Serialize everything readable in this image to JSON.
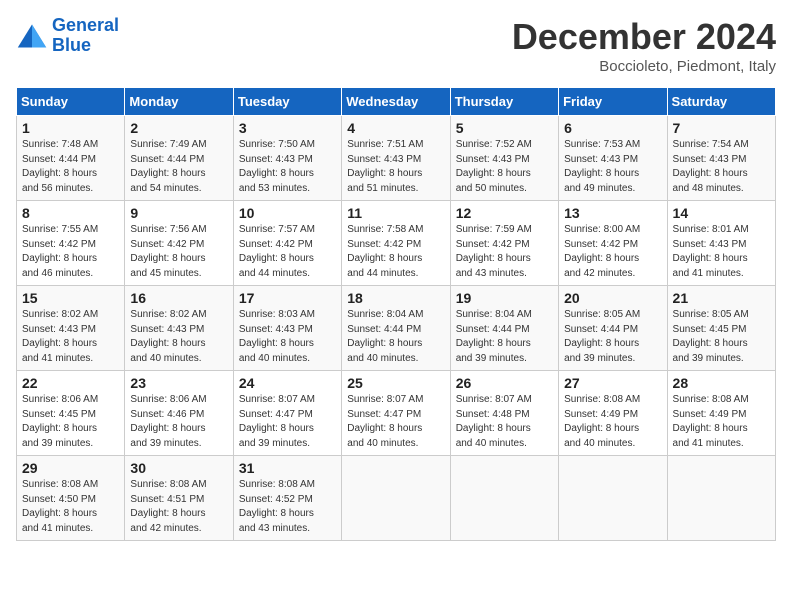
{
  "header": {
    "logo_line1": "General",
    "logo_line2": "Blue",
    "month": "December 2024",
    "location": "Boccioleto, Piedmont, Italy"
  },
  "days_of_week": [
    "Sunday",
    "Monday",
    "Tuesday",
    "Wednesday",
    "Thursday",
    "Friday",
    "Saturday"
  ],
  "weeks": [
    [
      {
        "day": "1",
        "info": "Sunrise: 7:48 AM\nSunset: 4:44 PM\nDaylight: 8 hours\nand 56 minutes."
      },
      {
        "day": "2",
        "info": "Sunrise: 7:49 AM\nSunset: 4:44 PM\nDaylight: 8 hours\nand 54 minutes."
      },
      {
        "day": "3",
        "info": "Sunrise: 7:50 AM\nSunset: 4:43 PM\nDaylight: 8 hours\nand 53 minutes."
      },
      {
        "day": "4",
        "info": "Sunrise: 7:51 AM\nSunset: 4:43 PM\nDaylight: 8 hours\nand 51 minutes."
      },
      {
        "day": "5",
        "info": "Sunrise: 7:52 AM\nSunset: 4:43 PM\nDaylight: 8 hours\nand 50 minutes."
      },
      {
        "day": "6",
        "info": "Sunrise: 7:53 AM\nSunset: 4:43 PM\nDaylight: 8 hours\nand 49 minutes."
      },
      {
        "day": "7",
        "info": "Sunrise: 7:54 AM\nSunset: 4:43 PM\nDaylight: 8 hours\nand 48 minutes."
      }
    ],
    [
      {
        "day": "8",
        "info": "Sunrise: 7:55 AM\nSunset: 4:42 PM\nDaylight: 8 hours\nand 46 minutes."
      },
      {
        "day": "9",
        "info": "Sunrise: 7:56 AM\nSunset: 4:42 PM\nDaylight: 8 hours\nand 45 minutes."
      },
      {
        "day": "10",
        "info": "Sunrise: 7:57 AM\nSunset: 4:42 PM\nDaylight: 8 hours\nand 44 minutes."
      },
      {
        "day": "11",
        "info": "Sunrise: 7:58 AM\nSunset: 4:42 PM\nDaylight: 8 hours\nand 44 minutes."
      },
      {
        "day": "12",
        "info": "Sunrise: 7:59 AM\nSunset: 4:42 PM\nDaylight: 8 hours\nand 43 minutes."
      },
      {
        "day": "13",
        "info": "Sunrise: 8:00 AM\nSunset: 4:42 PM\nDaylight: 8 hours\nand 42 minutes."
      },
      {
        "day": "14",
        "info": "Sunrise: 8:01 AM\nSunset: 4:43 PM\nDaylight: 8 hours\nand 41 minutes."
      }
    ],
    [
      {
        "day": "15",
        "info": "Sunrise: 8:02 AM\nSunset: 4:43 PM\nDaylight: 8 hours\nand 41 minutes."
      },
      {
        "day": "16",
        "info": "Sunrise: 8:02 AM\nSunset: 4:43 PM\nDaylight: 8 hours\nand 40 minutes."
      },
      {
        "day": "17",
        "info": "Sunrise: 8:03 AM\nSunset: 4:43 PM\nDaylight: 8 hours\nand 40 minutes."
      },
      {
        "day": "18",
        "info": "Sunrise: 8:04 AM\nSunset: 4:44 PM\nDaylight: 8 hours\nand 40 minutes."
      },
      {
        "day": "19",
        "info": "Sunrise: 8:04 AM\nSunset: 4:44 PM\nDaylight: 8 hours\nand 39 minutes."
      },
      {
        "day": "20",
        "info": "Sunrise: 8:05 AM\nSunset: 4:44 PM\nDaylight: 8 hours\nand 39 minutes."
      },
      {
        "day": "21",
        "info": "Sunrise: 8:05 AM\nSunset: 4:45 PM\nDaylight: 8 hours\nand 39 minutes."
      }
    ],
    [
      {
        "day": "22",
        "info": "Sunrise: 8:06 AM\nSunset: 4:45 PM\nDaylight: 8 hours\nand 39 minutes."
      },
      {
        "day": "23",
        "info": "Sunrise: 8:06 AM\nSunset: 4:46 PM\nDaylight: 8 hours\nand 39 minutes."
      },
      {
        "day": "24",
        "info": "Sunrise: 8:07 AM\nSunset: 4:47 PM\nDaylight: 8 hours\nand 39 minutes."
      },
      {
        "day": "25",
        "info": "Sunrise: 8:07 AM\nSunset: 4:47 PM\nDaylight: 8 hours\nand 40 minutes."
      },
      {
        "day": "26",
        "info": "Sunrise: 8:07 AM\nSunset: 4:48 PM\nDaylight: 8 hours\nand 40 minutes."
      },
      {
        "day": "27",
        "info": "Sunrise: 8:08 AM\nSunset: 4:49 PM\nDaylight: 8 hours\nand 40 minutes."
      },
      {
        "day": "28",
        "info": "Sunrise: 8:08 AM\nSunset: 4:49 PM\nDaylight: 8 hours\nand 41 minutes."
      }
    ],
    [
      {
        "day": "29",
        "info": "Sunrise: 8:08 AM\nSunset: 4:50 PM\nDaylight: 8 hours\nand 41 minutes."
      },
      {
        "day": "30",
        "info": "Sunrise: 8:08 AM\nSunset: 4:51 PM\nDaylight: 8 hours\nand 42 minutes."
      },
      {
        "day": "31",
        "info": "Sunrise: 8:08 AM\nSunset: 4:52 PM\nDaylight: 8 hours\nand 43 minutes."
      },
      {
        "day": "",
        "info": ""
      },
      {
        "day": "",
        "info": ""
      },
      {
        "day": "",
        "info": ""
      },
      {
        "day": "",
        "info": ""
      }
    ]
  ]
}
